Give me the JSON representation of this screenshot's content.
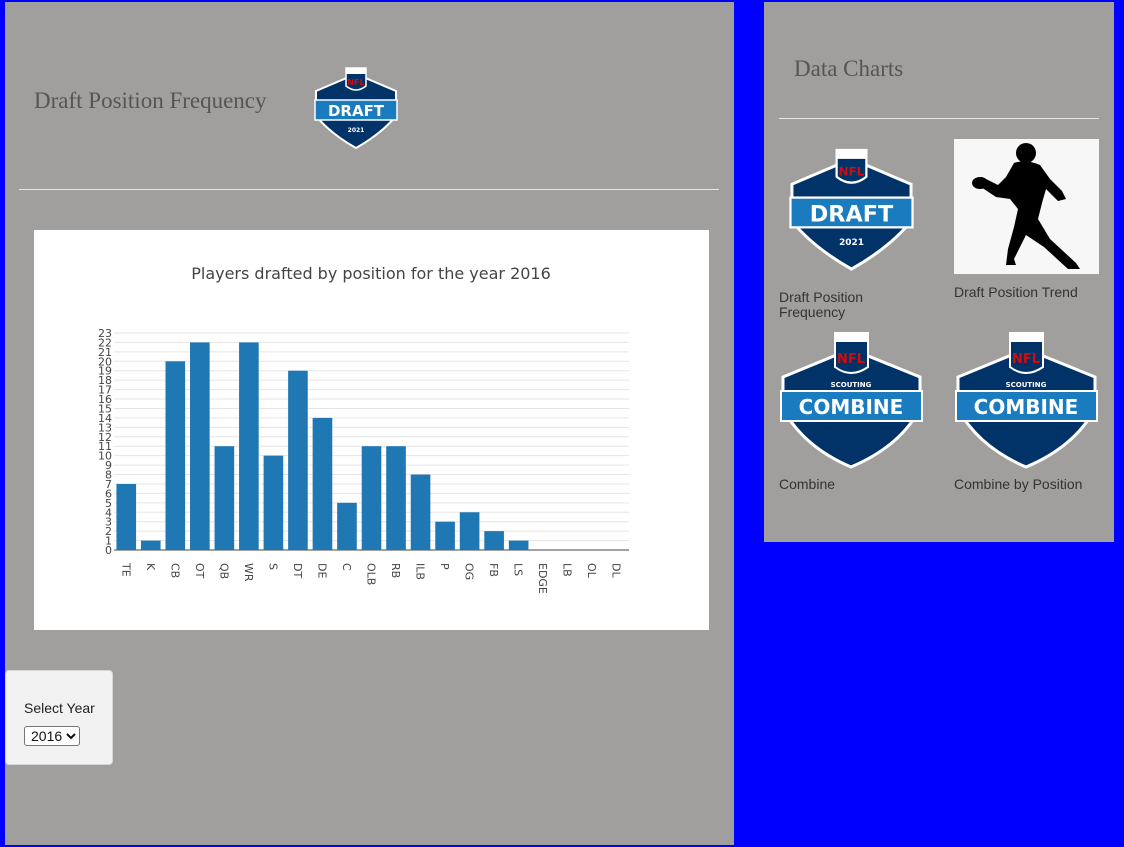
{
  "page": {
    "title": "Draft Position Frequency",
    "logo_text": {
      "league": "NFL",
      "word": "DRAFT",
      "year": "2021"
    }
  },
  "colors": {
    "background": "#0000ff",
    "panel": "#a09f9d",
    "bar": "#1f77b4",
    "logo_navy": "#013369",
    "logo_blue": "#1a7bbf",
    "logo_red": "#d50a0a"
  },
  "controls": {
    "year_label": "Select Year",
    "year_selected": "2016"
  },
  "sidebar": {
    "title": "Data Charts",
    "cards": [
      {
        "label": "Draft Position Frequency",
        "icon": "nfl-draft-logo"
      },
      {
        "label": "Draft Position Trend",
        "icon": "football-player-silhouette"
      },
      {
        "label": "Combine",
        "icon": "nfl-scouting-combine-logo"
      },
      {
        "label": "Combine by Position",
        "icon": "nfl-scouting-combine-logo"
      }
    ],
    "combine_logo_text": {
      "league": "NFL",
      "top": "SCOUTING",
      "word": "COMBINE"
    }
  },
  "chart_data": {
    "type": "bar",
    "title": "Players drafted by position for the year 2016",
    "categories": [
      "TE",
      "K",
      "CB",
      "OT",
      "QB",
      "WR",
      "S",
      "DT",
      "DE",
      "C",
      "OLB",
      "RB",
      "ILB",
      "P",
      "OG",
      "FB",
      "LS",
      "EDGE",
      "LB",
      "OL",
      "DL"
    ],
    "values": [
      7,
      1,
      20,
      22,
      11,
      22,
      10,
      19,
      14,
      5,
      11,
      11,
      8,
      3,
      4,
      2,
      1,
      0,
      0,
      0,
      0
    ],
    "ylim": [
      0,
      23
    ],
    "yticks": [
      0,
      1,
      2,
      3,
      4,
      5,
      6,
      7,
      8,
      9,
      10,
      11,
      12,
      13,
      14,
      15,
      16,
      17,
      18,
      19,
      20,
      21,
      22,
      23
    ],
    "grid": true,
    "xlabel": "",
    "ylabel": ""
  }
}
